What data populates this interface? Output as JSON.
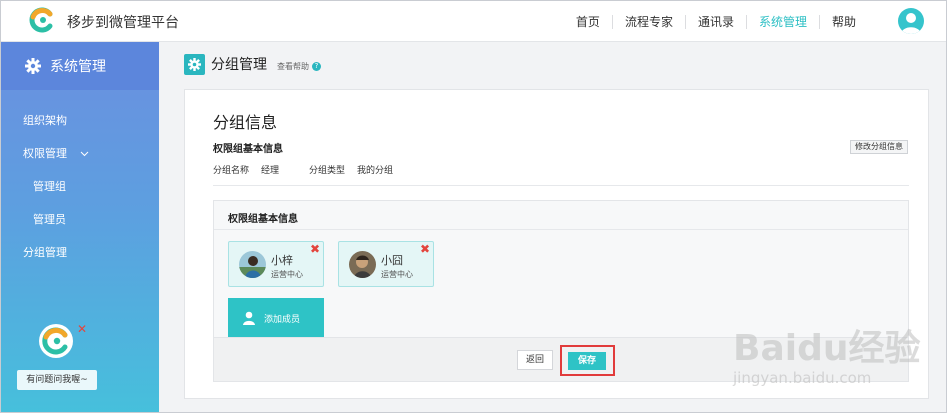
{
  "app": {
    "title": "移步到微管理平台"
  },
  "nav": {
    "items": [
      {
        "label": "首页",
        "active": false
      },
      {
        "label": "流程专家",
        "active": false
      },
      {
        "label": "通讯录",
        "active": false
      },
      {
        "label": "系统管理",
        "active": true
      },
      {
        "label": "帮助",
        "active": false
      }
    ]
  },
  "sidebar": {
    "header": "系统管理",
    "items": [
      {
        "label": "组织架构"
      },
      {
        "label": "权限管理"
      },
      {
        "label": "管理组"
      },
      {
        "label": "管理员"
      },
      {
        "label": "分组管理"
      }
    ],
    "helper_text": "有问题问我喔~"
  },
  "page": {
    "title": "分组管理",
    "help_link": "查看帮助"
  },
  "group_info": {
    "title": "分组信息",
    "subtitle": "权限组基本信息",
    "edit_button": "修改分组信息",
    "name_label": "分组名称",
    "name_value": "经理",
    "type_label": "分组类型",
    "type_value": "我的分组"
  },
  "members_panel": {
    "title": "权限组基本信息",
    "members": [
      {
        "name": "小梓",
        "dept": "运营中心"
      },
      {
        "name": "小囧",
        "dept": "运营中心"
      }
    ],
    "add_button": "添加成员",
    "back_button": "返回",
    "save_button": "保存"
  },
  "watermark": {
    "brand": "Baidu经验",
    "url": "jingyan.baidu.com"
  },
  "colors": {
    "accent": "#2ec3c6",
    "nav_active": "#2bbfc4",
    "highlight": "#e13b3b",
    "remove": "#e3453d"
  }
}
